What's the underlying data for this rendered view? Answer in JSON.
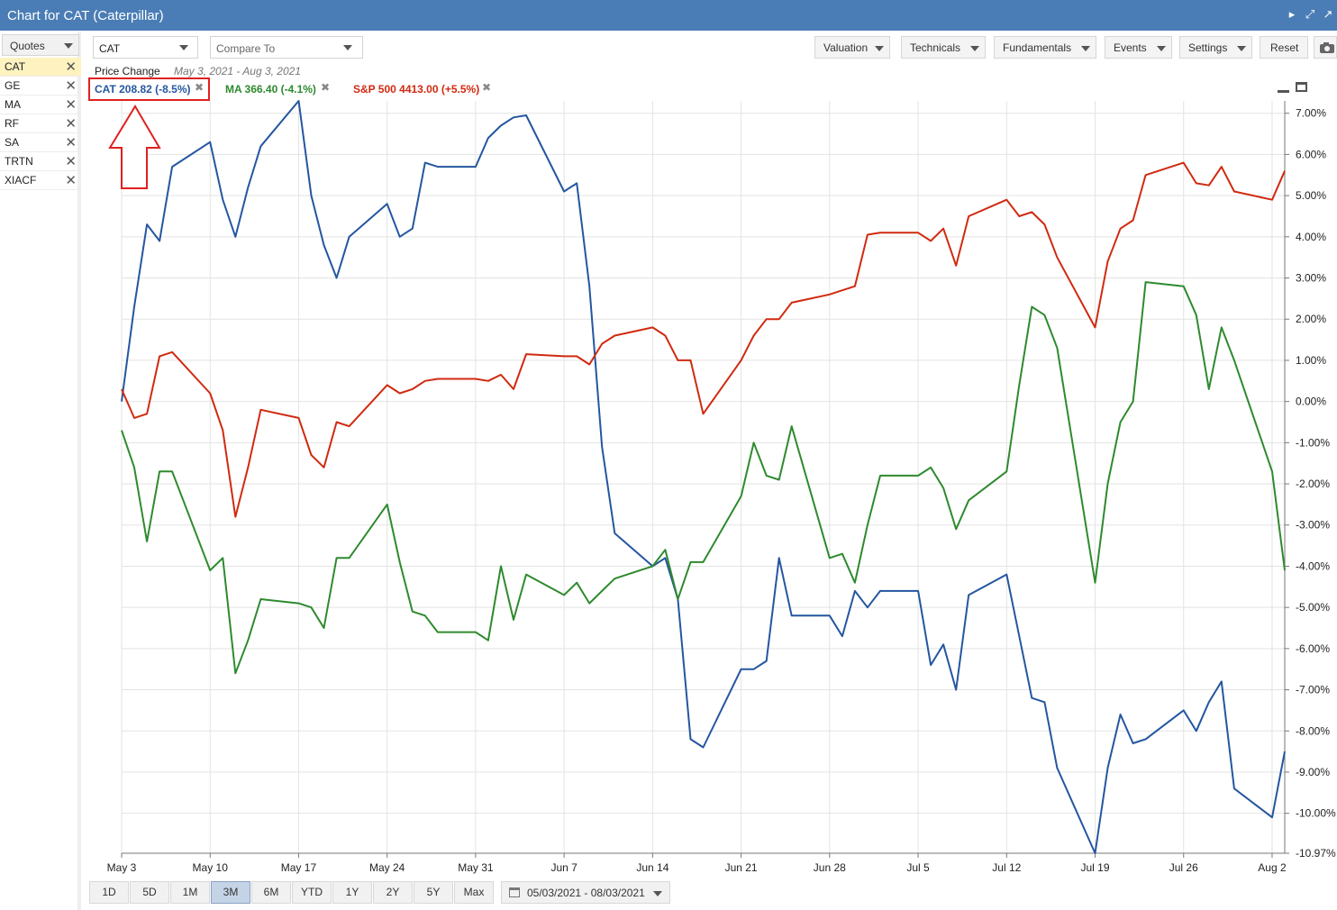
{
  "window": {
    "title": "Chart for CAT (Caterpillar)"
  },
  "sidebar": {
    "dropdown_label": "Quotes",
    "symbols": [
      "CAT",
      "GE",
      "MA",
      "RF",
      "SA",
      "TRTN",
      "XIACF"
    ]
  },
  "toolbar": {
    "symbol_value": "CAT",
    "compare_placeholder": "Compare To",
    "menus": [
      "Valuation",
      "Technicals",
      "Fundamentals",
      "Events",
      "Settings"
    ],
    "reset_label": "Reset"
  },
  "chart_header": {
    "label": "Price Change",
    "range": "May 3, 2021 - Aug 3, 2021"
  },
  "legend": [
    {
      "text": "CAT 208.82 (-8.5%)",
      "color": "#2456a0"
    },
    {
      "text": "MA 366.40 (-4.1%)",
      "color": "#2e8a2e"
    },
    {
      "text": "S&P 500 4413.00 (+5.5%)",
      "color": "#d02a10"
    }
  ],
  "bottom_bar": {
    "ranges": [
      "1D",
      "5D",
      "1M",
      "3M",
      "6M",
      "YTD",
      "1Y",
      "2Y",
      "5Y",
      "Max"
    ],
    "active_range": "3M",
    "date_range": "05/03/2021 - 08/03/2021"
  },
  "colors": {
    "titlebar": "#4a7db5",
    "annotation": "#e02020"
  },
  "chart_data": {
    "type": "line",
    "x_tick_labels": [
      "May 3",
      "May 10",
      "May 17",
      "May 24",
      "May 31",
      "Jun 7",
      "Jun 14",
      "Jun 21",
      "Jun 28",
      "Jul 5",
      "Jul 12",
      "Jul 19",
      "Jul 26",
      "Aug 2"
    ],
    "y_tick_labels": [
      "7.00%",
      "6.00%",
      "5.00%",
      "4.00%",
      "3.00%",
      "2.00%",
      "1.00%",
      "0.00%",
      "-1.00%",
      "-2.00%",
      "-3.00%",
      "-4.00%",
      "-5.00%",
      "-6.00%",
      "-7.00%",
      "-8.00%",
      "-9.00%",
      "-10.00%",
      "-10.97%"
    ],
    "ylim": [
      -10.97,
      7.3
    ],
    "x_day_range": [
      0,
      92
    ],
    "grid": true,
    "series": [
      {
        "name": "CAT",
        "color": "#2456a0",
        "x": [
          0,
          1,
          2,
          3,
          4,
          7,
          8,
          9,
          10,
          11,
          14,
          15,
          16,
          17,
          18,
          21,
          22,
          23,
          24,
          25,
          28,
          29,
          30,
          31,
          32,
          35,
          36,
          37,
          38,
          39,
          42,
          43,
          44,
          45,
          46,
          49,
          50,
          51,
          52,
          53,
          56,
          57,
          58,
          59,
          60,
          63,
          64,
          65,
          66,
          67,
          70,
          71,
          72,
          73,
          74,
          77,
          78,
          79,
          80,
          81,
          84,
          85,
          86,
          87,
          88,
          91,
          92
        ],
        "values": [
          0.0,
          2.3,
          4.3,
          3.9,
          5.7,
          6.3,
          4.9,
          4.0,
          5.2,
          6.2,
          7.3,
          5.0,
          3.8,
          3.0,
          4.0,
          4.8,
          4.0,
          4.2,
          5.8,
          5.7,
          5.7,
          6.4,
          6.7,
          6.9,
          6.95,
          5.1,
          5.3,
          2.8,
          -1.1,
          -3.2,
          -4.0,
          -3.8,
          -4.8,
          -8.2,
          -8.4,
          -6.5,
          -6.5,
          -6.3,
          -3.8,
          -5.2,
          -5.2,
          -5.7,
          -4.6,
          -5.0,
          -4.6,
          -4.6,
          -6.4,
          -5.9,
          -7.0,
          -4.7,
          -4.2,
          -5.7,
          -7.2,
          -7.3,
          -8.9,
          -10.97,
          -8.9,
          -7.6,
          -8.3,
          -8.2,
          -7.5,
          -8.0,
          -7.3,
          -6.8,
          -9.4,
          -10.1,
          -8.5
        ]
      },
      {
        "name": "MA",
        "color": "#2e8a2e",
        "x": [
          0,
          1,
          2,
          3,
          4,
          7,
          8,
          9,
          10,
          11,
          14,
          15,
          16,
          17,
          18,
          21,
          22,
          23,
          24,
          25,
          28,
          29,
          30,
          31,
          32,
          35,
          36,
          37,
          38,
          39,
          42,
          43,
          44,
          45,
          46,
          49,
          50,
          51,
          52,
          53,
          56,
          57,
          58,
          59,
          60,
          63,
          64,
          65,
          66,
          67,
          70,
          71,
          72,
          73,
          74,
          77,
          78,
          79,
          80,
          81,
          84,
          85,
          86,
          87,
          88,
          91,
          92
        ],
        "values": [
          -0.7,
          -1.6,
          -3.4,
          -1.7,
          -1.7,
          -4.1,
          -3.8,
          -6.6,
          -5.8,
          -4.8,
          -4.9,
          -5.0,
          -5.5,
          -3.8,
          -3.8,
          -2.5,
          -3.9,
          -5.1,
          -5.2,
          -5.6,
          -5.6,
          -5.8,
          -4.0,
          -5.3,
          -4.2,
          -4.7,
          -4.4,
          -4.9,
          -4.6,
          -4.3,
          -4.0,
          -3.6,
          -4.8,
          -3.9,
          -3.9,
          -2.3,
          -1.0,
          -1.8,
          -1.9,
          -0.6,
          -3.8,
          -3.7,
          -4.4,
          -3.0,
          -1.8,
          -1.8,
          -1.6,
          -2.1,
          -3.1,
          -2.4,
          -1.7,
          0.4,
          2.3,
          2.1,
          1.3,
          -4.4,
          -2.0,
          -0.5,
          0.0,
          2.9,
          2.8,
          2.1,
          0.3,
          1.8,
          1.0,
          -1.7,
          -4.1
        ]
      },
      {
        "name": "S&P 500",
        "color": "#d02a10",
        "x": [
          0,
          1,
          2,
          3,
          4,
          7,
          8,
          9,
          10,
          11,
          14,
          15,
          16,
          17,
          18,
          21,
          22,
          23,
          24,
          25,
          28,
          29,
          30,
          31,
          32,
          35,
          36,
          37,
          38,
          39,
          42,
          43,
          44,
          45,
          46,
          49,
          50,
          51,
          52,
          53,
          56,
          57,
          58,
          59,
          60,
          63,
          64,
          65,
          66,
          67,
          70,
          71,
          72,
          73,
          74,
          77,
          78,
          79,
          80,
          81,
          84,
          85,
          86,
          87,
          88,
          91,
          92
        ],
        "values": [
          0.3,
          -0.4,
          -0.3,
          1.1,
          1.2,
          0.2,
          -0.7,
          -2.8,
          -1.6,
          -0.2,
          -0.4,
          -1.3,
          -1.6,
          -0.5,
          -0.6,
          0.4,
          0.2,
          0.3,
          0.5,
          0.55,
          0.55,
          0.5,
          0.65,
          0.3,
          1.15,
          1.1,
          1.1,
          0.9,
          1.4,
          1.6,
          1.8,
          1.6,
          1.0,
          1.0,
          -0.3,
          1.0,
          1.6,
          2.0,
          2.0,
          2.4,
          2.6,
          2.7,
          2.8,
          4.05,
          4.1,
          4.1,
          3.9,
          4.2,
          3.3,
          4.5,
          4.9,
          4.5,
          4.6,
          4.3,
          3.5,
          1.8,
          3.4,
          4.2,
          4.4,
          5.5,
          5.8,
          5.3,
          5.25,
          5.7,
          5.1,
          4.9,
          5.6
        ]
      }
    ]
  }
}
